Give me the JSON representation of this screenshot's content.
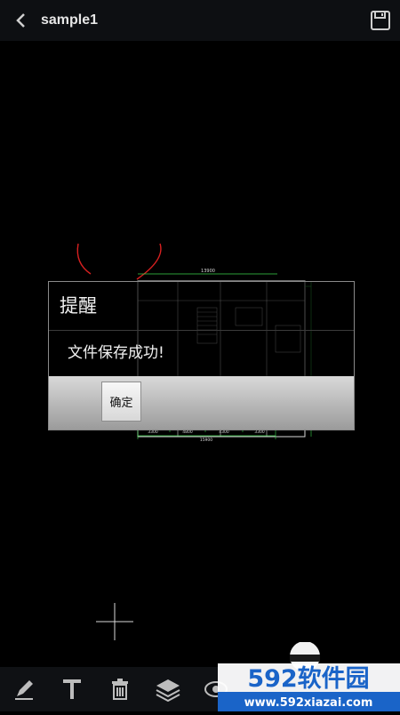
{
  "header": {
    "title": "sample1"
  },
  "dialog": {
    "title": "提醒",
    "message": "文件保存成功!",
    "ok_label": "确定"
  },
  "plan_labels": {
    "top_dimension": "13900",
    "bottom_dimension": "15900",
    "bottom_segments": [
      "3300",
      "4800",
      "4300",
      "3300"
    ]
  },
  "watermark": {
    "brand": "592软件园",
    "url": "www.592xiazai.com"
  },
  "toolbar": {
    "icons": [
      "pen-icon",
      "text-icon",
      "trash-icon",
      "layers-icon",
      "eye-icon"
    ]
  },
  "colors": {
    "brand_blue": "#1a64c8",
    "plan_white": "#d8d8d8",
    "plan_green": "#3ad34a",
    "plan_red": "#d82020"
  }
}
